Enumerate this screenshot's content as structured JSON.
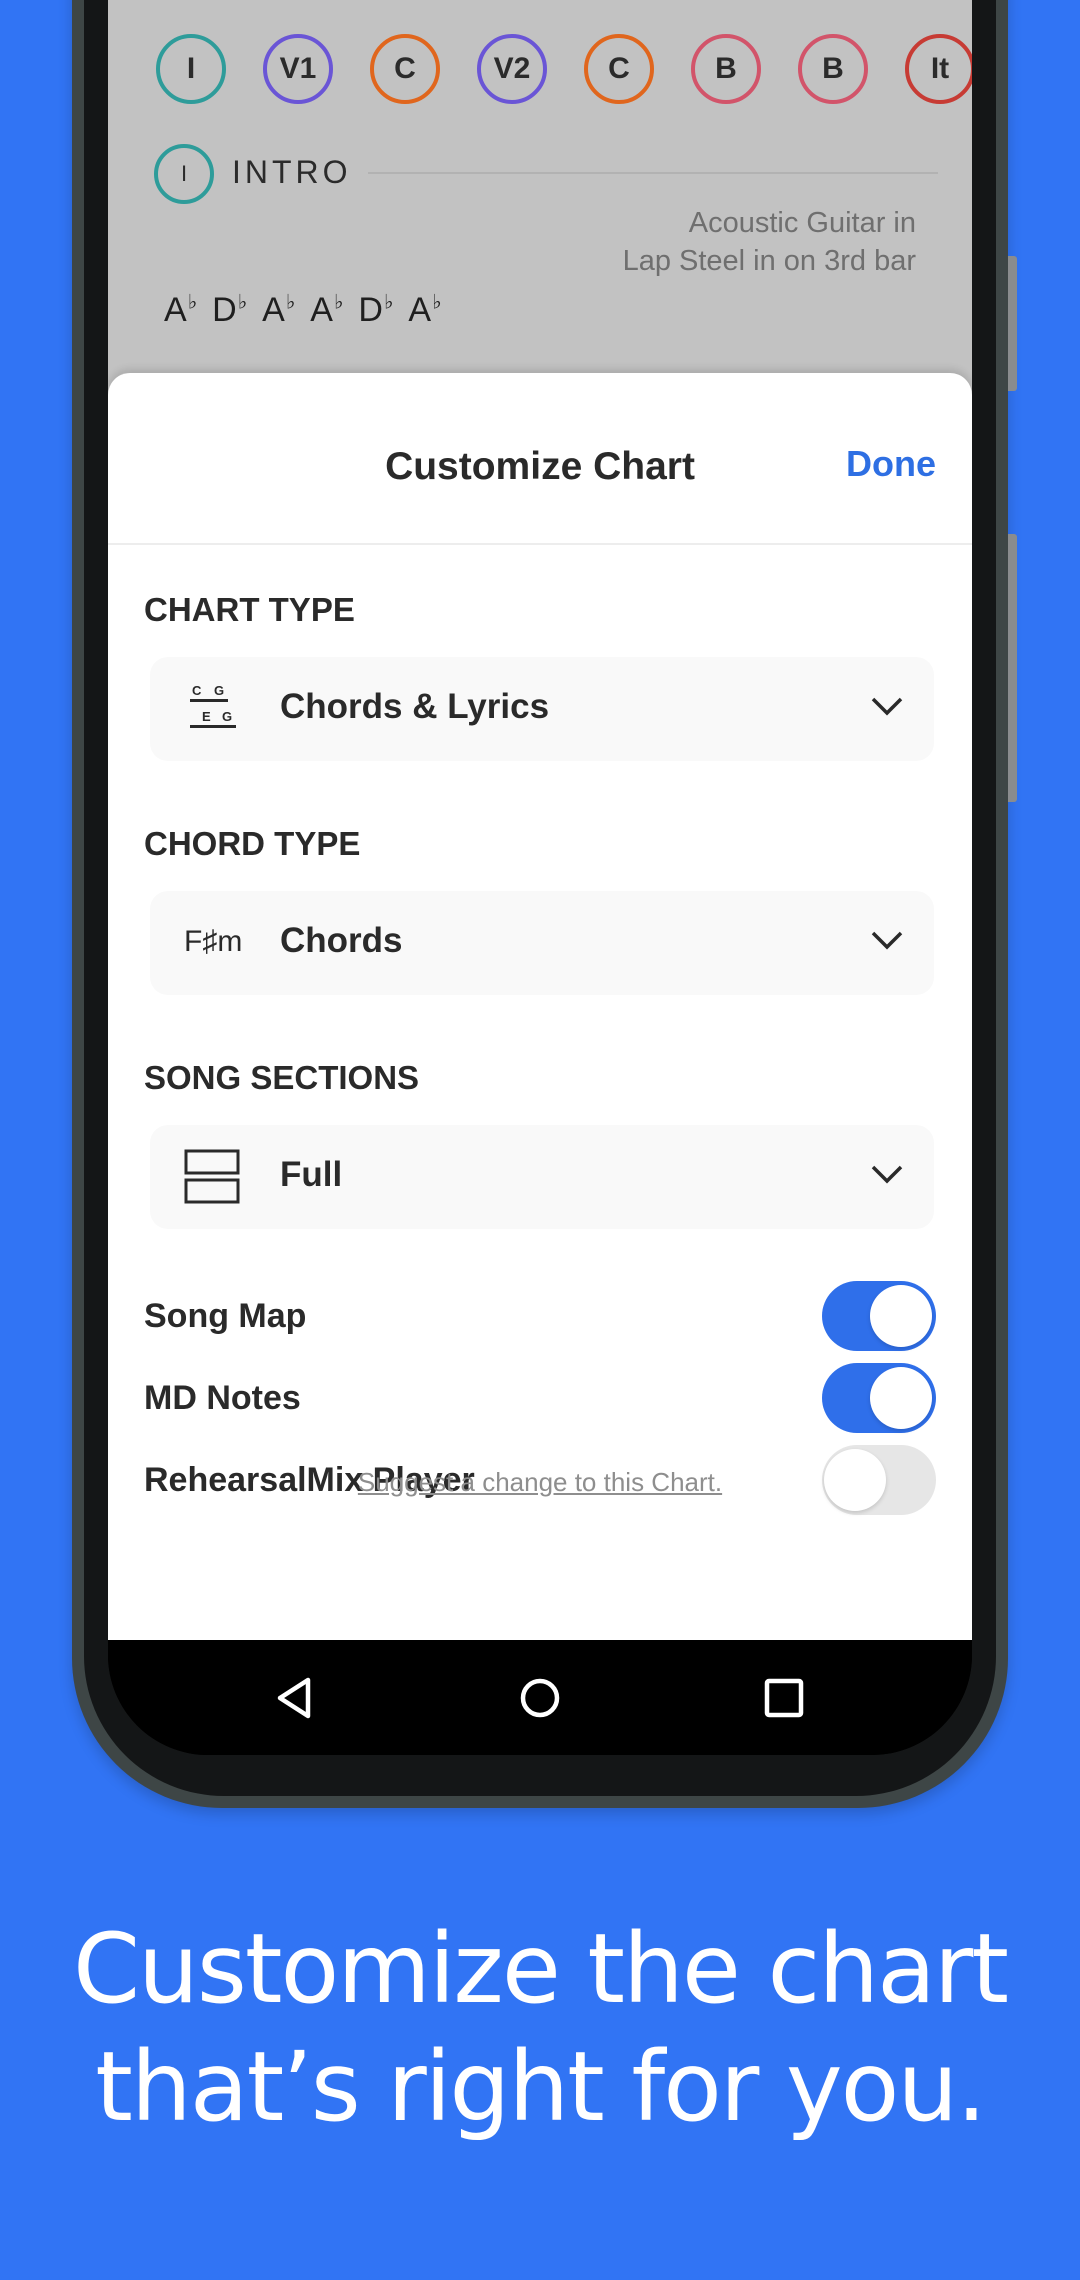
{
  "song_map": {
    "sections": [
      {
        "label": "I",
        "color": "#2E9C9A"
      },
      {
        "label": "V1",
        "color": "#6A55D6"
      },
      {
        "label": "C",
        "color": "#E0661D"
      },
      {
        "label": "V2",
        "color": "#6A55D6"
      },
      {
        "label": "C",
        "color": "#E0661D"
      },
      {
        "label": "B",
        "color": "#D2546A"
      },
      {
        "label": "B",
        "color": "#D2546A"
      },
      {
        "label": "It",
        "color": "#C73B34"
      }
    ]
  },
  "chart_preview": {
    "section_badge": "I",
    "section_name": "INTRO",
    "notes": [
      "Acoustic Guitar in",
      "Lap Steel in on 3rd bar"
    ],
    "chords": [
      "A♭",
      "D♭",
      "A♭",
      "A♭",
      "D♭",
      "A♭"
    ]
  },
  "sheet": {
    "title": "Customize Chart",
    "done_label": "Done",
    "chart_type": {
      "label": "CHART TYPE",
      "value": "Chords & Lyrics",
      "icon": "chords-lyrics-icon",
      "icon_text_top": "C G",
      "icon_text_bottom": "E G"
    },
    "chord_type": {
      "label": "CHORD TYPE",
      "value": "Chords",
      "icon": "chord-symbol-icon",
      "icon_text": "F♯m"
    },
    "song_sections": {
      "label": "SONG SECTIONS",
      "value": "Full",
      "icon": "sections-icon"
    },
    "toggles": [
      {
        "label": "Song Map",
        "on": true
      },
      {
        "label": "MD Notes",
        "on": true
      },
      {
        "label": "RehearsalMix Player",
        "on": false
      }
    ],
    "suggest_link": "Suggest a change to this Chart."
  },
  "navbar": {
    "back": "back-icon",
    "home": "home-icon",
    "recents": "recents-icon"
  },
  "tagline": {
    "line1": "Customize the chart",
    "line2": "that’s right for you."
  },
  "colors": {
    "background": "#3174F4",
    "accent": "#2F6FEA"
  }
}
